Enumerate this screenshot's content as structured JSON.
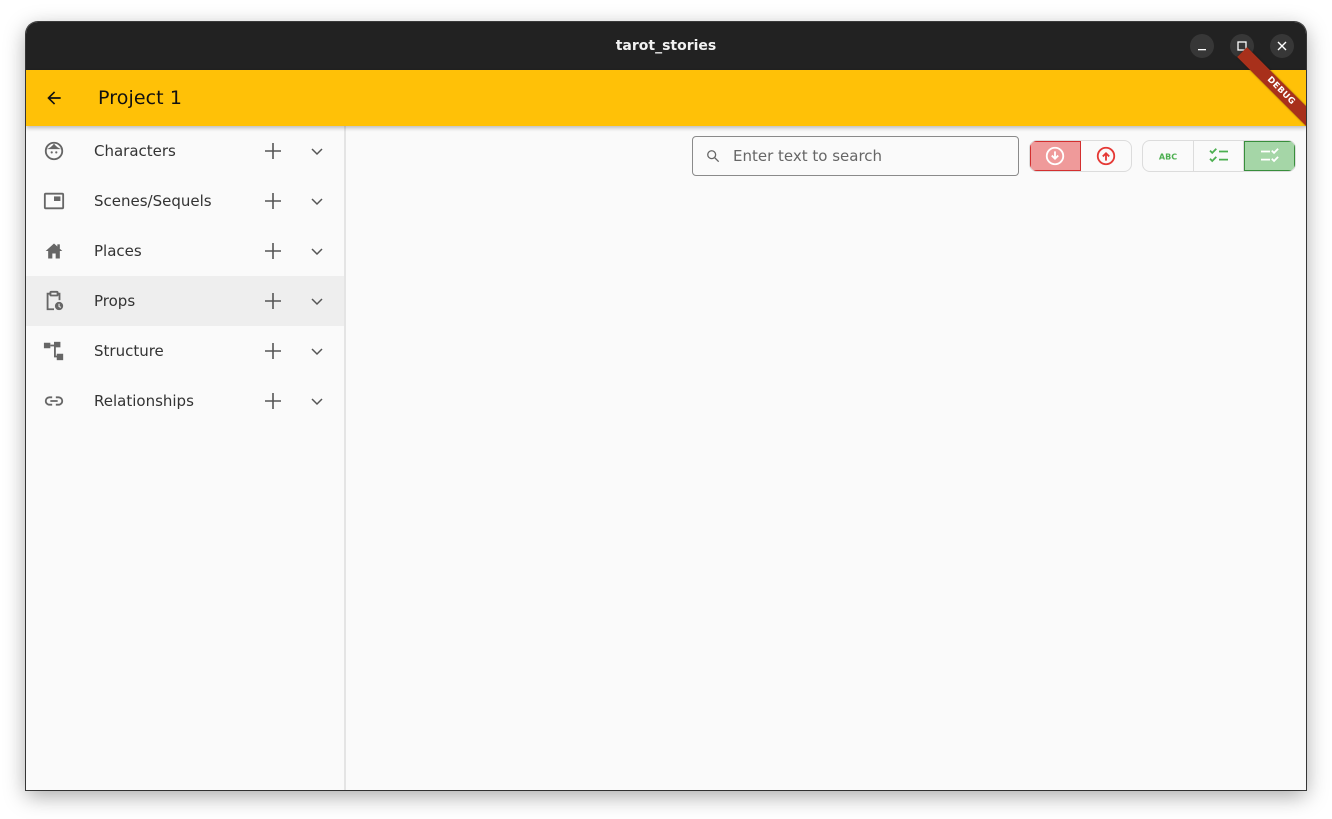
{
  "window": {
    "title": "tarot_stories",
    "controls": {
      "minimize": "minimize-icon",
      "maximize": "maximize-icon",
      "close": "close-icon"
    }
  },
  "appbar": {
    "back_icon": "arrow-back-icon",
    "title": "Project 1",
    "debug_banner": "DEBUG",
    "color": "#ffc107"
  },
  "sidebar": {
    "items": [
      {
        "label": "Characters",
        "icon": "face-icon",
        "add_icon": "plus-icon",
        "expand_icon": "chevron-down-icon"
      },
      {
        "label": "Scenes/Sequels",
        "icon": "picture-in-picture-icon",
        "add_icon": "plus-icon",
        "expand_icon": "chevron-down-icon"
      },
      {
        "label": "Places",
        "icon": "house-icon",
        "add_icon": "plus-icon",
        "expand_icon": "chevron-down-icon"
      },
      {
        "label": "Props",
        "icon": "pending-actions-icon",
        "add_icon": "plus-icon",
        "expand_icon": "chevron-down-icon",
        "hovered": true
      },
      {
        "label": "Structure",
        "icon": "account-tree-icon",
        "add_icon": "plus-icon",
        "expand_icon": "chevron-down-icon"
      },
      {
        "label": "Relationships",
        "icon": "link-icon",
        "add_icon": "plus-icon",
        "expand_icon": "chevron-down-icon"
      }
    ]
  },
  "toolbar": {
    "search": {
      "placeholder": "Enter text to search",
      "value": "",
      "icon": "search-icon"
    },
    "sort_buttons": [
      {
        "name": "sort-descending",
        "icon": "arrow-circle-down-icon",
        "selected": true
      },
      {
        "name": "sort-ascending",
        "icon": "arrow-circle-up-icon",
        "selected": false
      }
    ],
    "view_buttons": [
      {
        "name": "view-abc",
        "icon": "abc-icon",
        "label": "ABC",
        "selected": false
      },
      {
        "name": "view-checklist",
        "icon": "checklist-icon",
        "selected": false
      },
      {
        "name": "view-checklist-rtl",
        "icon": "checklist-rtl-icon",
        "selected": true
      }
    ],
    "colors": {
      "sort_accent": "#d32f2f",
      "sort_selected_bg": "#ef9a9a",
      "view_accent": "#4caf50",
      "view_selected_bg": "#a5d6a7"
    }
  }
}
